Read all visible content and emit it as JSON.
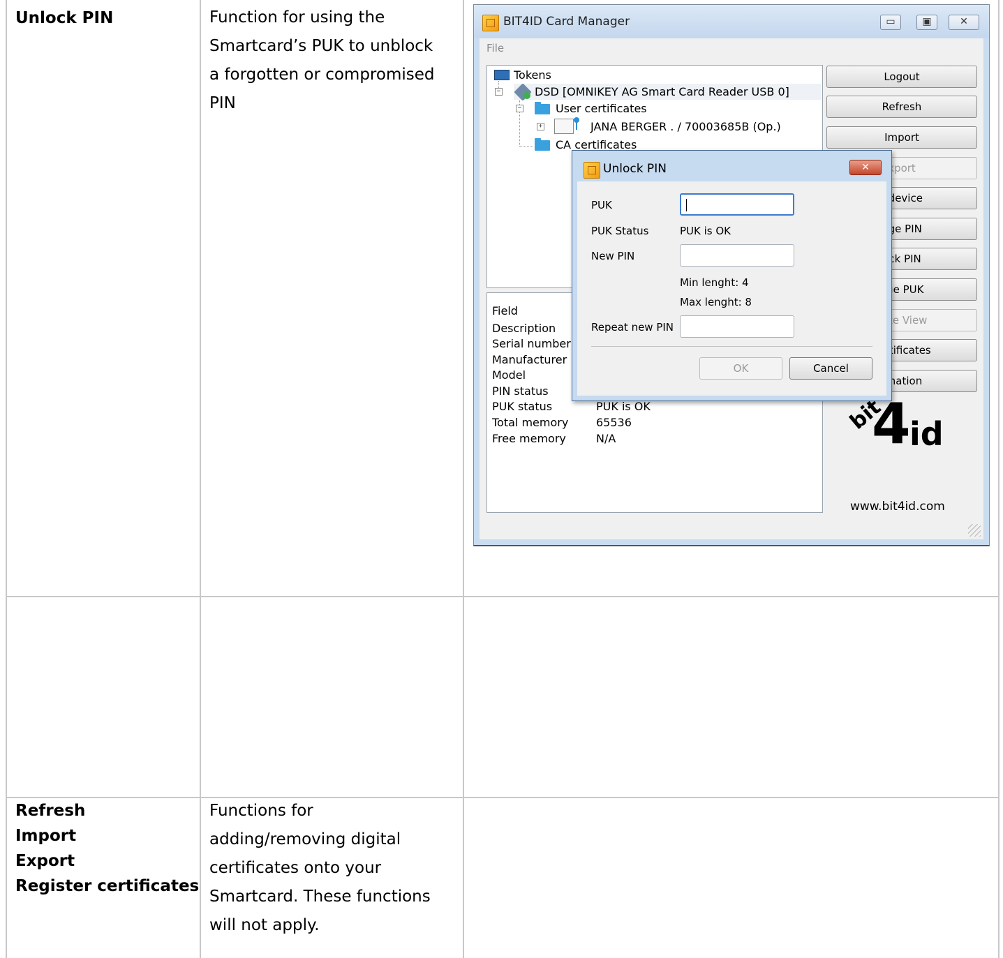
{
  "rows": [
    {
      "term_lines": [
        "Unlock PIN"
      ],
      "desc_lines": [
        "Function for using the",
        "Smartcard’s PUK to unblock",
        "a forgotten or compromised",
        "PIN"
      ]
    },
    {
      "term_lines": [],
      "desc_lines": []
    },
    {
      "term_lines": [
        "Refresh",
        "Import",
        "Export",
        "Register certificates"
      ],
      "desc_lines": [
        "Functions for",
        "adding/removing digital",
        "certificates onto your",
        "Smartcard. These functions",
        "will not apply."
      ]
    }
  ],
  "screenshot": {
    "window_title": "BIT4ID Card Manager",
    "caption_buttons": [
      "▭",
      "▣",
      "✕"
    ],
    "menu": {
      "file": "File"
    },
    "tree": {
      "root": "Tokens",
      "reader": "DSD [OMNIKEY AG Smart Card Reader USB 0]",
      "user_certificates": "User certificates",
      "certificate": "JANA BERGER . / 70003685B (Op.)",
      "ca_certificates": "CA certificates",
      "expanders": {
        "collapse": "−",
        "expand": "+"
      }
    },
    "details": {
      "header": "Field",
      "fields": [
        "Description",
        "Serial number",
        "Manufacturer",
        "Model",
        "PIN status",
        "PUK status",
        "Total memory",
        "Free memory"
      ],
      "visible_values": {
        "puk_status": "PUK is OK",
        "total_memory": "65536",
        "free_memory": "N/A"
      }
    },
    "side_buttons": [
      "Logout",
      "Refresh",
      "Import",
      "xport",
      "t device",
      "nge PIN",
      "ock PIN",
      "nge PUK",
      "cate View",
      "certificates",
      "rmation"
    ],
    "logo": {
      "bit": "bit",
      "four": "4",
      "id": "id"
    },
    "website": "www.bit4id.com",
    "dialog": {
      "title": "Unlock PIN",
      "close": "✕",
      "puk_label": "PUK",
      "puk_value": "",
      "puk_status_label": "PUK Status",
      "puk_status_value": "PUK is OK",
      "new_pin_label": "New PIN",
      "min_length": "Min lenght: 4",
      "max_length": "Max lenght: 8",
      "repeat_label": "Repeat new PIN",
      "ok": "OK",
      "cancel": "Cancel"
    }
  }
}
